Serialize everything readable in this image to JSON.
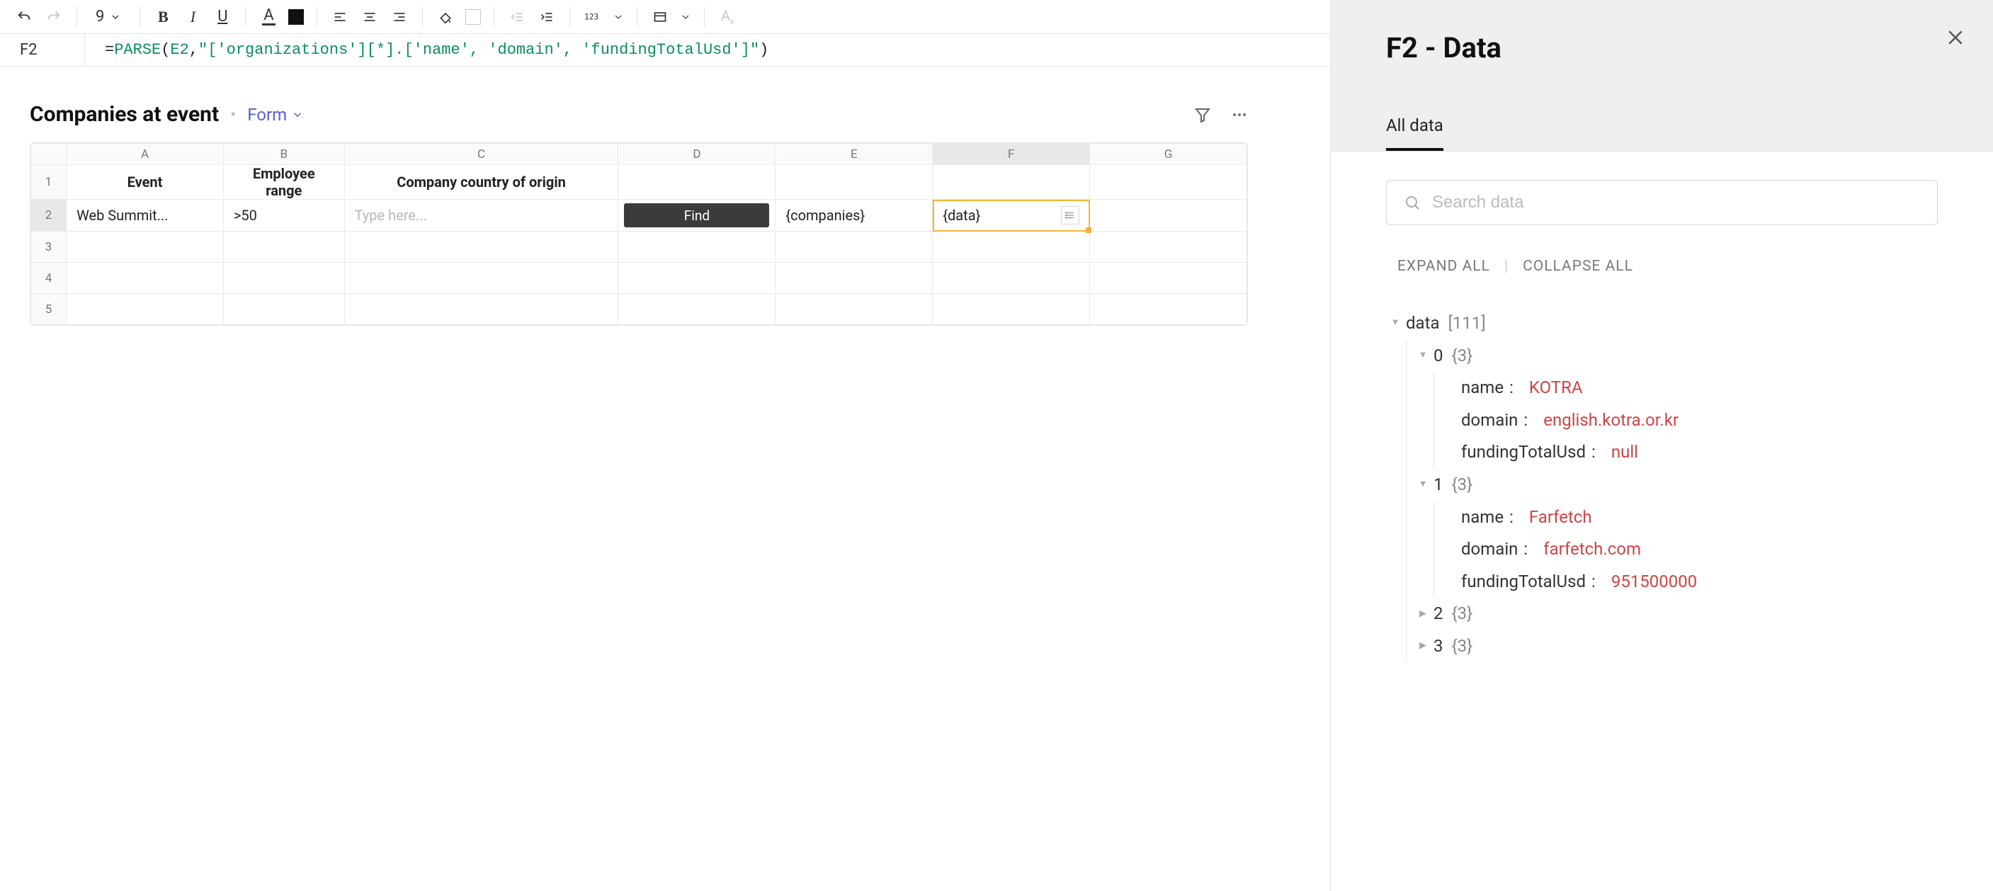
{
  "toolbar": {
    "fontSize": "9"
  },
  "formulaBar": {
    "cellRef": "F2",
    "formulaPrefix": "=",
    "fnName": "PARSE",
    "open": "(",
    "argRef": "E2",
    "comma": ",",
    "argStr": "\"['organizations'][*].['name', 'domain', 'fundingTotalUsd']\"",
    "close": ")"
  },
  "sheet": {
    "title": "Companies at event",
    "formLabel": "Form",
    "columns": [
      "A",
      "B",
      "C",
      "D",
      "E",
      "F",
      "G"
    ],
    "selectedCol": "F",
    "headers": {
      "A": "Event",
      "B": "Employee range",
      "C": "Company country of origin",
      "D": "",
      "E": "",
      "F": "",
      "G": ""
    },
    "row2": {
      "A": "Web Summit...",
      "B": ">50",
      "C_placeholder": "Type here...",
      "D_button": "Find",
      "E": "{companies}",
      "F": "{data}",
      "G": ""
    },
    "emptyRows": [
      "3",
      "4",
      "5"
    ]
  },
  "panel": {
    "title": "F2 - Data",
    "tab": "All data",
    "searchPlaceholder": "Search data",
    "expandAll": "EXPAND ALL",
    "collapseAll": "COLLAPSE ALL",
    "tree": {
      "rootKey": "data",
      "rootCount": "[111]",
      "items": [
        {
          "idx": "0",
          "meta": "{3}",
          "expanded": true,
          "props": [
            {
              "k": "name",
              "v": "KOTRA",
              "t": "str"
            },
            {
              "k": "domain",
              "v": "english.kotra.or.kr",
              "t": "str"
            },
            {
              "k": "fundingTotalUsd",
              "v": "null",
              "t": "null"
            }
          ]
        },
        {
          "idx": "1",
          "meta": "{3}",
          "expanded": true,
          "props": [
            {
              "k": "name",
              "v": "Farfetch",
              "t": "str"
            },
            {
              "k": "domain",
              "v": "farfetch.com",
              "t": "str"
            },
            {
              "k": "fundingTotalUsd",
              "v": "951500000",
              "t": "num"
            }
          ]
        },
        {
          "idx": "2",
          "meta": "{3}",
          "expanded": false
        },
        {
          "idx": "3",
          "meta": "{3}",
          "expanded": false
        }
      ]
    }
  }
}
